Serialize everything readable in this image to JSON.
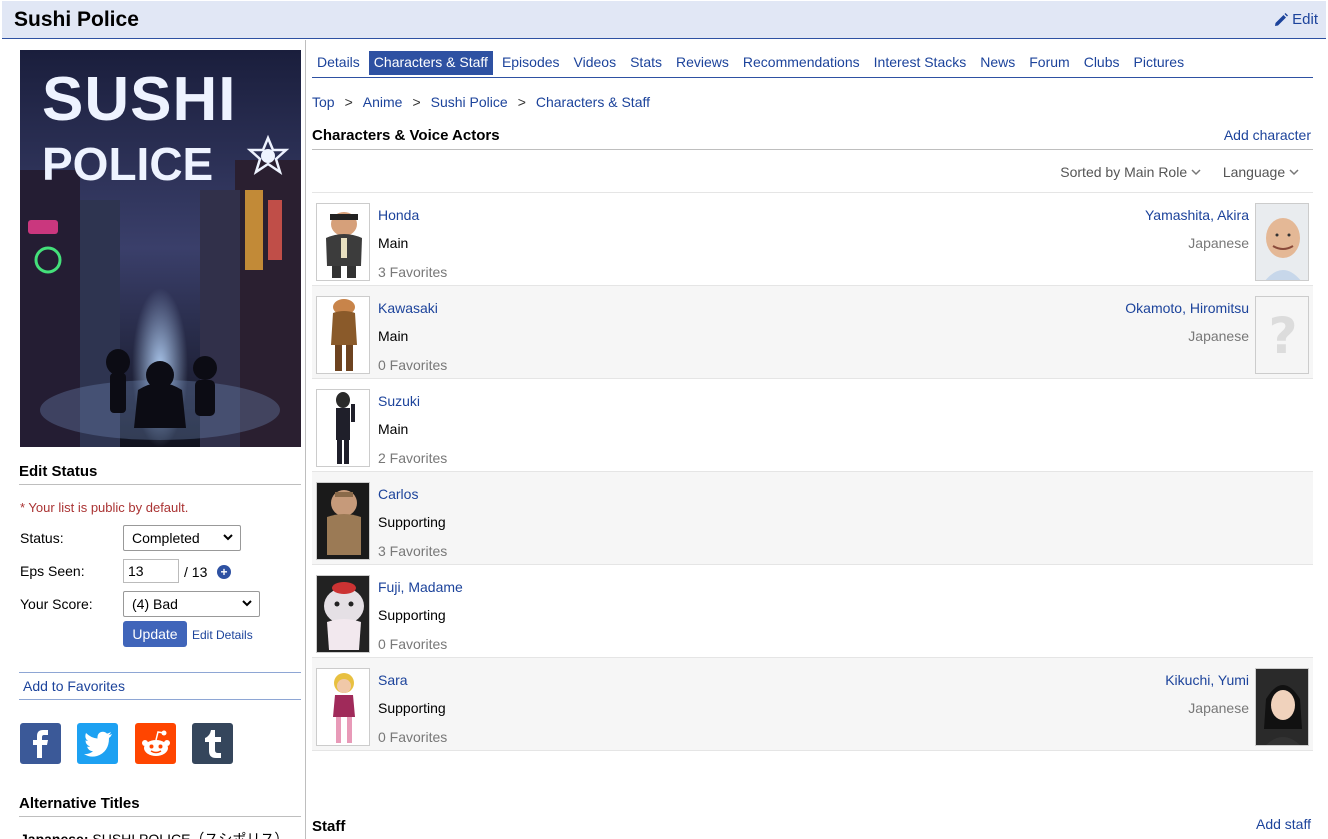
{
  "header": {
    "title": "Sushi Police",
    "edit_label": "Edit"
  },
  "poster": {
    "title_line1": "SUSHI",
    "title_line2": "POLICE"
  },
  "edit_status": {
    "heading": "Edit Status",
    "note": "* Your list is public by default.",
    "status_label": "Status:",
    "status_value": "Completed",
    "eps_label": "Eps Seen:",
    "eps_value": "13",
    "eps_total": "/ 13",
    "score_label": "Your Score:",
    "score_value": "(4) Bad",
    "update_label": "Update",
    "edit_details_label": "Edit Details"
  },
  "favorites_label": "Add to Favorites",
  "share": [
    {
      "icon": "facebook-icon",
      "color": "#3b5998"
    },
    {
      "icon": "twitter-icon",
      "color": "#1da1f2"
    },
    {
      "icon": "reddit-icon",
      "color": "#ff4500"
    },
    {
      "icon": "tumblr-icon",
      "color": "#35465c"
    }
  ],
  "alt_titles": {
    "heading": "Alternative Titles",
    "japanese_label": "Japanese:",
    "japanese_value": "SUSHI POLICE（スシポリス）"
  },
  "tabs": [
    "Details",
    "Characters & Staff",
    "Episodes",
    "Videos",
    "Stats",
    "Reviews",
    "Recommendations",
    "Interest Stacks",
    "News",
    "Forum",
    "Clubs",
    "Pictures"
  ],
  "active_tab": "Characters & Staff",
  "breadcrumb": [
    {
      "label": "Top"
    },
    {
      "label": ">"
    },
    {
      "label": "Anime"
    },
    {
      "label": ">"
    },
    {
      "label": "Sushi Police"
    },
    {
      "label": ">"
    },
    {
      "label": "Characters & Staff"
    }
  ],
  "characters_section": {
    "heading": "Characters & Voice Actors",
    "add_label": "Add character",
    "sort_label": "Sorted by Main Role",
    "language_label": "Language"
  },
  "characters": [
    {
      "name": "Honda",
      "role": "Main",
      "favorites": "3 Favorites",
      "va_name": "Yamashita, Akira",
      "va_lang": "Japanese"
    },
    {
      "name": "Kawasaki",
      "role": "Main",
      "favorites": "0 Favorites",
      "va_name": "Okamoto, Hiromitsu",
      "va_lang": "Japanese"
    },
    {
      "name": "Suzuki",
      "role": "Main",
      "favorites": "2 Favorites",
      "va_name": "",
      "va_lang": ""
    },
    {
      "name": "Carlos",
      "role": "Supporting",
      "favorites": "3 Favorites",
      "va_name": "",
      "va_lang": ""
    },
    {
      "name": "Fuji, Madame",
      "role": "Supporting",
      "favorites": "0 Favorites",
      "va_name": "",
      "va_lang": ""
    },
    {
      "name": "Sara",
      "role": "Supporting",
      "favorites": "0 Favorites",
      "va_name": "Kikuchi, Yumi",
      "va_lang": "Japanese"
    }
  ],
  "staff_section": {
    "heading": "Staff",
    "add_label": "Add staff"
  }
}
